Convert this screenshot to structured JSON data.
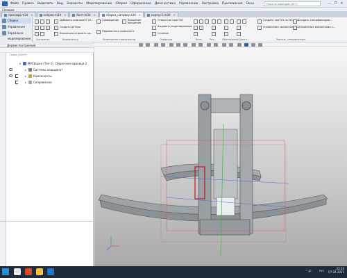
{
  "app": {
    "menu": [
      "Файл",
      "Правка",
      "Выделить",
      "Вид",
      "Элементы",
      "Моделирование",
      "Сборка",
      "Оформление",
      "Диагностика",
      "Управление",
      "Настройка",
      "Приложения",
      "Окно"
    ],
    "menu2": "Справка",
    "search_placeholder": "Поиск по командам (Alt+/)",
    "win_min": "—",
    "win_max": "❐",
    "win_close": "✕"
  },
  "tabs": [
    {
      "label": "присадд.m3d"
    },
    {
      "label": "напрвн.m3d"
    },
    {
      "label": "болт.m3d"
    },
    {
      "label": "сборка_напрвну.a3d"
    },
    {
      "label": "корпус1.m3d"
    }
  ],
  "ribbon": {
    "modes": [
      "Сборка",
      "Управление",
      "Зеркально моделирование"
    ],
    "groups": [
      {
        "label": "Системная",
        "cmds": []
      },
      {
        "label": "Компоненты",
        "cmds": [
          "Добавить компонент из...",
          "Создать деталь",
          "Зеркально отразить ко..."
        ]
      },
      {
        "label": "Размещение компонентов",
        "cmds": [
          "Совмещение",
          "Переместить компонент",
          "Вращение",
          "вращение"
        ]
      },
      {
        "label": "Операции",
        "cmds": [
          "Отверстие простое",
          "Выдавить моделирование",
          "Сечение"
        ]
      },
      {
        "label": "Вспо...",
        "cmds": []
      },
      {
        "label": "Раз...",
        "cmds": []
      },
      {
        "label": "Обозначение",
        "cmds": []
      },
      {
        "label": "Диагн...",
        "cmds": []
      },
      {
        "label": "Чертеж, спецификация",
        "cmds": [
          "Создать чертеж по модели",
          "Управление связанными ч...",
          "Создать спецификацию...",
          "Управление связанными с..."
        ]
      }
    ]
  },
  "tree": {
    "title": "Дерево построения",
    "search_placeholder": "Поиск (Ctrl+F)",
    "items": [
      {
        "label": "МУСборка (Тел-1). Сборочная единица 2",
        "indent": 0
      },
      {
        "label": "Системы координат",
        "indent": 1
      },
      {
        "label": "Компоненты",
        "indent": 1
      },
      {
        "label": "Сопряжения",
        "indent": 1
      }
    ]
  },
  "taskbar": {
    "lang": "РУС",
    "time": "23:24",
    "date": "07.04.2021",
    "tray": "^ 🔊"
  },
  "colors": {
    "accent": "#1e63b5",
    "part": "#9aa0a6",
    "bbox": "#e05c5c",
    "axis_green": "#3db54a",
    "axis_blue": "#4a6fd6"
  }
}
